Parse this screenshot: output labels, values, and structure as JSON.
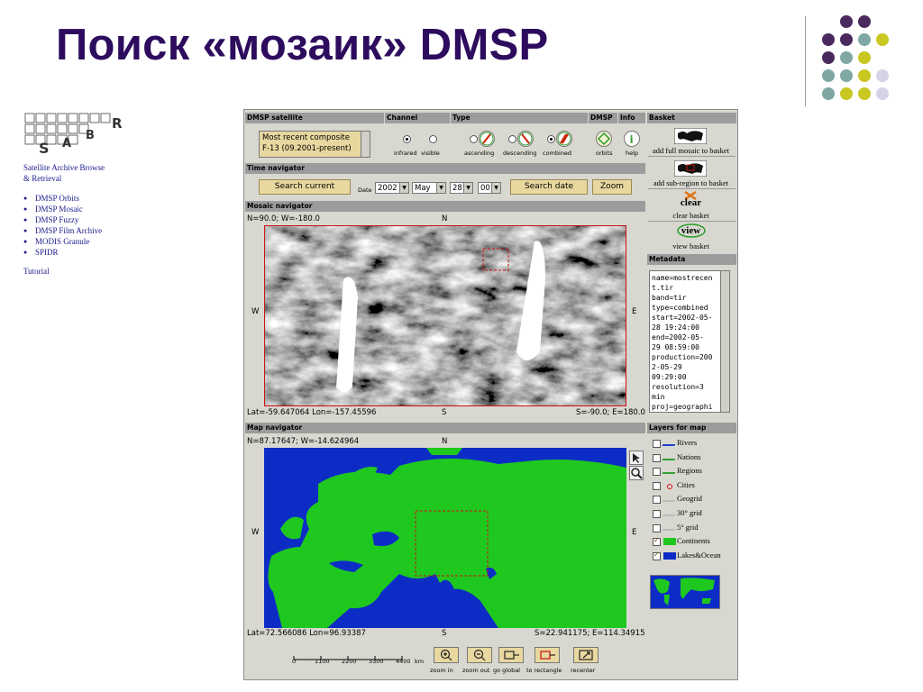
{
  "slide": {
    "title": "Поиск «мозаик» DMSP",
    "dot_colors": [
      "#4a2a5e",
      "#7fa7a4",
      "#c9c721",
      "#d4d4e6"
    ]
  },
  "sidebar": {
    "logo_letters": "SABR",
    "title_line1": "Satellite Archive Browse",
    "title_line2": "& Retrieval",
    "links": [
      "DMSP Orbits",
      "DMSP Mosaic",
      "DMSP Fuzzy",
      "DMSP Film Archive",
      "MODIS Granule",
      "SPIDR"
    ],
    "tutorial": "Tutorial"
  },
  "app": {
    "headers": {
      "satellite": "DMSP satellite",
      "channel": "Channel",
      "type": "Type",
      "dmsp": "DMSP",
      "info": "Info",
      "basket": "Basket",
      "time_nav": "Time navigator",
      "mosaic_nav": "Mosaic navigator",
      "metadata": "Metadata",
      "map_nav": "Map navigator",
      "layers": "Layers for map"
    },
    "satellite_list": [
      "Most recent composite",
      "F-13 (09.2001-present)"
    ],
    "channel_labels": [
      "infrared",
      "visible"
    ],
    "type_labels": [
      "ascending",
      "descending",
      "combined"
    ],
    "dmsp_label": "orbits",
    "info_label": "help",
    "time": {
      "search_current": "Search current",
      "date_label": "Date",
      "year": "2002",
      "month": "May",
      "day": "28",
      "hour": "00",
      "search_date": "Search date",
      "zoom": "Zoom"
    },
    "mosaic": {
      "nw": "N=90.0; W=-180.0",
      "n": "N",
      "w": "W",
      "e": "E",
      "s": "S",
      "latlon": "Lat=-59.647064 Lon=-157.45596",
      "se": "S=-90.0; E=180.0"
    },
    "map": {
      "nw": "N=87.17647; W=-14.624964",
      "n": "N",
      "w": "W",
      "e": "E",
      "s": "S",
      "latlon": "Lat=72.566086 Lon=96.93387",
      "se": "S=22.941175; E=114.34915",
      "land_color": "#1fc81f",
      "water_color": "#0d2cc6"
    },
    "scale": {
      "ticks": [
        "0",
        "1100",
        "2200",
        "3300",
        "4400"
      ],
      "unit": "km"
    },
    "tools": [
      "zoom in",
      "zoom out",
      "go global",
      "to rectangle",
      "recenter"
    ],
    "basket": {
      "add_full": "add full mosaic to basket",
      "add_sub": "add sub-region to basket",
      "clear_icon": "clear",
      "clear": "clear basket",
      "view_icon": "view",
      "view": "view basket"
    },
    "metadata_lines": "name=mostrecen\nt.tir\nband=tir\ntype=combined\nstart=2002-05-\n28 19:24:00\nend=2002-05-\n29 08:59:00\nproduction=200\n2-05-29\n09:29:00\nresolution=3\nmin\nproj=geographi",
    "layers": [
      {
        "label": "Rivers",
        "checked": false
      },
      {
        "label": "Nations",
        "checked": false
      },
      {
        "label": "Regions",
        "checked": false
      },
      {
        "label": "Cities",
        "checked": false
      },
      {
        "label": "Geogrid",
        "checked": false
      },
      {
        "label": "30° grid",
        "checked": false
      },
      {
        "label": "5° grid",
        "checked": false
      },
      {
        "label": "Continents",
        "checked": true
      },
      {
        "label": "Lakes&Ocean",
        "checked": true
      }
    ]
  }
}
